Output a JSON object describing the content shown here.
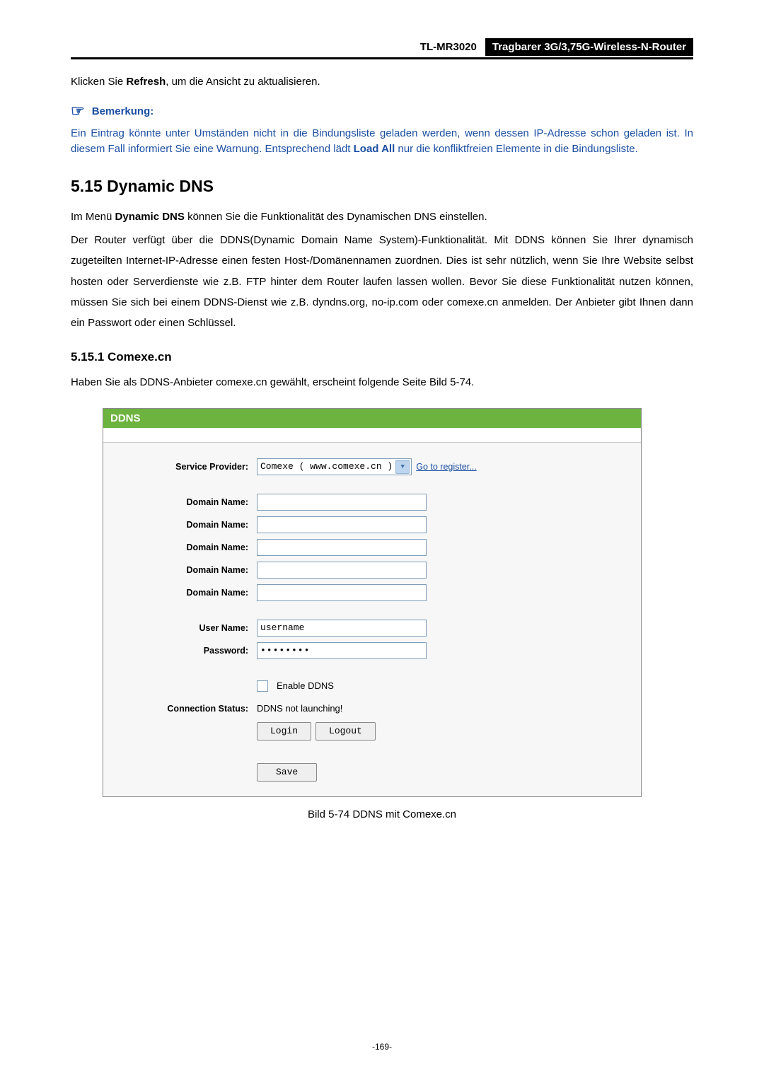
{
  "header": {
    "model": "TL-MR3020",
    "title": "Tragbarer 3G/3,75G-Wireless-N-Router"
  },
  "intro": {
    "line1_pre": "Klicken Sie ",
    "line1_bold": "Refresh",
    "line1_post": ", um die Ansicht zu aktualisieren."
  },
  "note": {
    "label": "Bemerkung:",
    "body_pre": "Ein Eintrag könnte unter Umständen nicht in die Bindungsliste geladen werden, wenn dessen IP-Adresse schon geladen ist. In diesem Fall informiert Sie eine Warnung. Entsprechend lädt ",
    "body_bold": "Load All",
    "body_post": " nur die konfliktfreien Elemente in die Bindungsliste."
  },
  "h2": "5.15  Dynamic DNS",
  "p1_pre": "Im Menü ",
  "p1_bold": "Dynamic DNS",
  "p1_post": " können Sie die Funktionalität des Dynamischen DNS einstellen.",
  "p2": "Der Router verfügt über die DDNS(Dynamic Domain Name System)-Funktionalität. Mit DDNS können Sie Ihrer dynamisch zugeteilten Internet-IP-Adresse einen festen Host-/Domänennamen zuordnen. Dies ist sehr nützlich, wenn Sie Ihre Website selbst hosten oder Serverdienste wie z.B. FTP hinter dem Router laufen lassen wollen. Bevor Sie diese Funktionalität nutzen können, müssen Sie sich bei einem DDNS-Dienst wie z.B. dyndns.org, no-ip.com oder comexe.cn anmelden. Der Anbieter gibt Ihnen dann ein Passwort oder einen Schlüssel.",
  "h3": "5.15.1  Comexe.cn",
  "p3": "Haben Sie als DDNS-Anbieter comexe.cn gewählt, erscheint folgende Seite Bild 5-74.",
  "fig": {
    "title": "DDNS",
    "label_provider": "Service Provider:",
    "provider_value": "Comexe ( www.comexe.cn )",
    "register_link": "Go to register...",
    "label_domain": "Domain Name:",
    "label_user": "User Name:",
    "user_value": "username",
    "label_pass": "Password:",
    "pass_value": "••••••••",
    "enable_label": "Enable DDNS",
    "label_conn": "Connection Status:",
    "conn_value": "DDNS not launching!",
    "btn_login": "Login",
    "btn_logout": "Logout",
    "btn_save": "Save"
  },
  "caption": "Bild 5-74 DDNS mit Comexe.cn",
  "footer": "-169-"
}
